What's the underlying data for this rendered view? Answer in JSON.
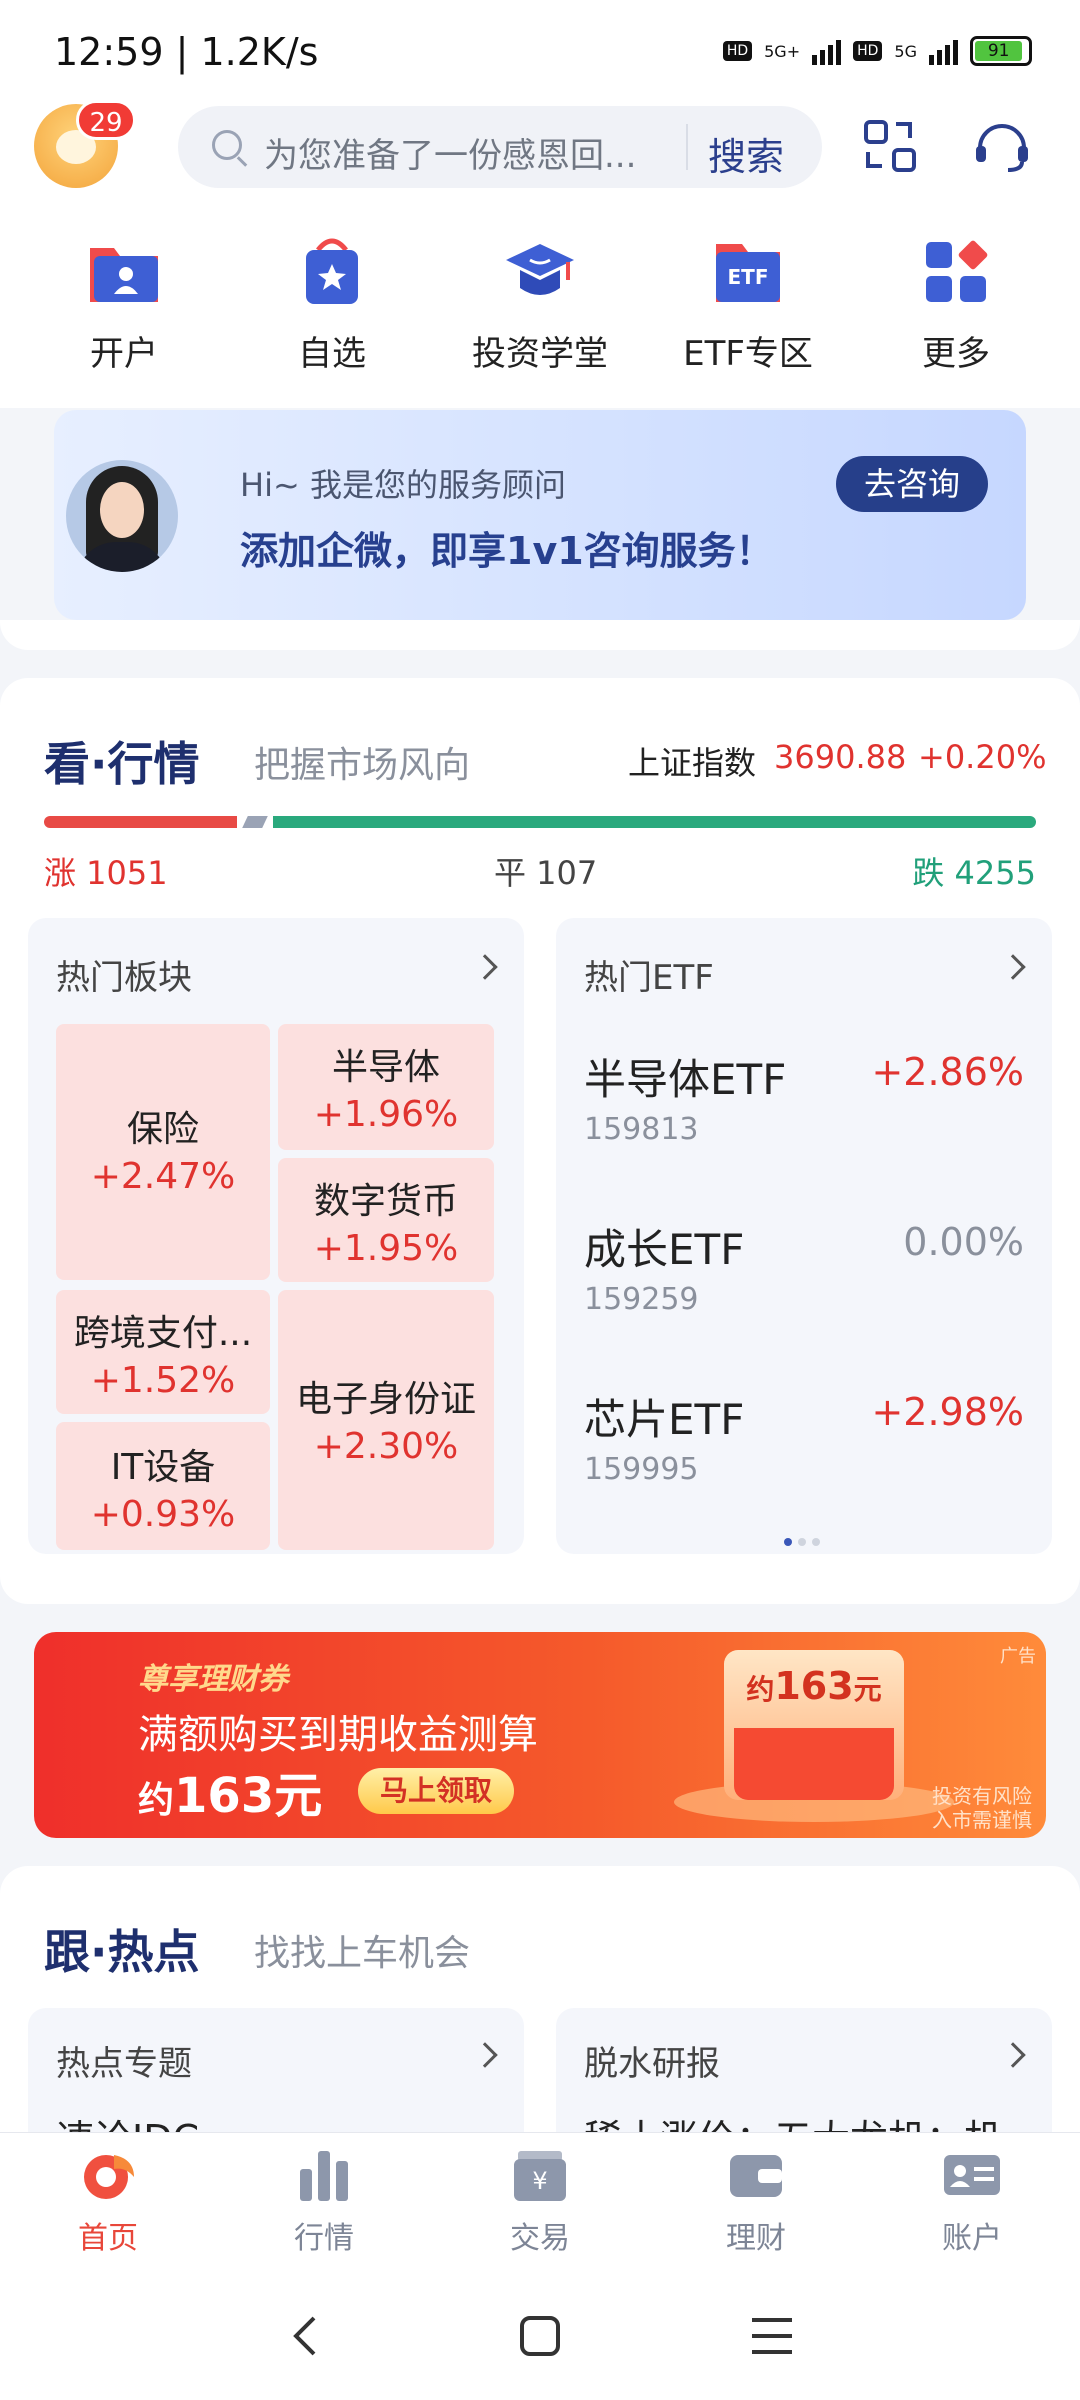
{
  "status_bar": {
    "time": "12:59 | 1.2K/s",
    "network_1": "5G+",
    "network_2": "5G",
    "hd": "HD",
    "battery": "91"
  },
  "header": {
    "notification_count": "29",
    "search_placeholder": "为您准备了一份感恩回...",
    "search_button": "搜索"
  },
  "quick_nav": [
    {
      "label": "开户",
      "icon": "folder-user-icon"
    },
    {
      "label": "自选",
      "icon": "bag-star-icon"
    },
    {
      "label": "投资学堂",
      "icon": "graduation-cap-icon"
    },
    {
      "label": "ETF专区",
      "icon": "etf-folder-icon"
    },
    {
      "label": "更多",
      "icon": "grid-more-icon"
    }
  ],
  "advisor": {
    "greeting": "Hi~ 我是您的服务顾问",
    "message": "添加企微，即享1v1咨询服务！",
    "button": "去咨询"
  },
  "market": {
    "title_a": "看",
    "title_dot": "·",
    "title_b": "行情",
    "subtitle": "把握市场风向",
    "index_name": "上证指数",
    "index_value": "3690.88",
    "index_change": "+0.20%",
    "breadth": {
      "up_label": "涨 1051",
      "flat_label": "平 107",
      "down_label": "跌 4255",
      "up": 1051,
      "flat": 107,
      "down": 4255
    },
    "sectors": {
      "header": "热门板块",
      "items": [
        {
          "name": "保险",
          "change": "+2.47%"
        },
        {
          "name": "半导体",
          "change": "+1.96%"
        },
        {
          "name": "数字货币",
          "change": "+1.95%"
        },
        {
          "name": "跨境支付...",
          "change": "+1.52%"
        },
        {
          "name": "电子身份证",
          "change": "+2.30%"
        },
        {
          "name": "IT设备",
          "change": "+0.93%"
        }
      ]
    },
    "etfs": {
      "header": "热门ETF",
      "items": [
        {
          "name": "半导体ETF",
          "code": "159813",
          "change": "+2.86%",
          "color": "#e0332f"
        },
        {
          "name": "成长ETF",
          "code": "159259",
          "change": "0.00%",
          "color": "#8a909c"
        },
        {
          "name": "芯片ETF",
          "code": "159995",
          "change": "+2.98%",
          "color": "#e0332f"
        }
      ]
    }
  },
  "ad": {
    "kicker": "尊享理财券",
    "line1": "满额购买到期收益测算",
    "amount_prefix": "约",
    "amount": "163元",
    "cta": "马上领取",
    "tag": "广告",
    "envelope_prefix": "约",
    "envelope_amount": "163",
    "envelope_unit": "元",
    "risk_line1": "投资有风险",
    "risk_line2": "入市需谨慎"
  },
  "follow": {
    "title_a": "跟",
    "title_dot": "·",
    "title_b": "热点",
    "subtitle": "找找上车机会",
    "cards": [
      {
        "header": "热点专题",
        "peek": "速论IDC"
      },
      {
        "header": "脱水研报",
        "peek": "稀土涨价：五大龙机：机"
      }
    ]
  },
  "tab_bar": [
    {
      "label": "首页",
      "icon": "home-icon",
      "active": true
    },
    {
      "label": "行情",
      "icon": "bar-chart-icon",
      "active": false
    },
    {
      "label": "交易",
      "icon": "yuan-trade-icon",
      "active": false
    },
    {
      "label": "理财",
      "icon": "wallet-icon",
      "active": false
    },
    {
      "label": "账户",
      "icon": "id-card-icon",
      "active": false
    }
  ],
  "colors": {
    "accent_red": "#e0332f",
    "accent_green": "#21a07a",
    "brand_navy": "#263f8a"
  }
}
